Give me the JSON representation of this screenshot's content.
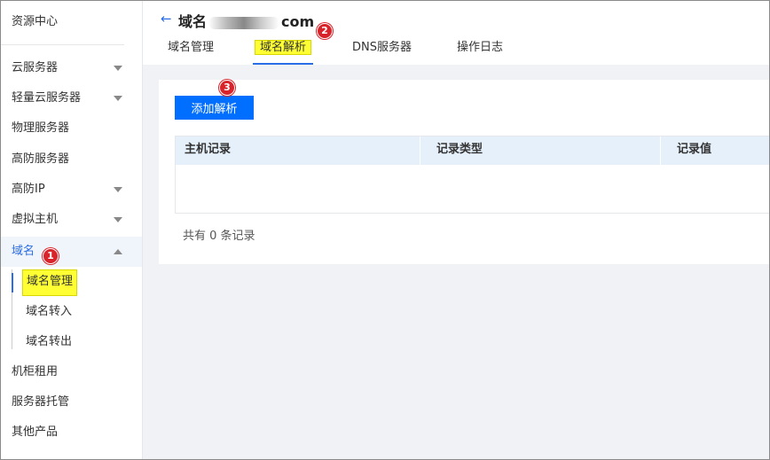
{
  "sidebar": {
    "top_label": "资源中心",
    "items": [
      {
        "label": "云服务器",
        "has_caret": true
      },
      {
        "label": "轻量云服务器",
        "has_caret": true
      },
      {
        "label": "物理服务器",
        "has_caret": false
      },
      {
        "label": "高防服务器",
        "has_caret": false
      },
      {
        "label": "高防IP",
        "has_caret": true
      },
      {
        "label": "虚拟主机",
        "has_caret": true
      },
      {
        "label": "域名",
        "has_caret": true,
        "expanded": true
      },
      {
        "label": "机柜租用",
        "has_caret": false
      },
      {
        "label": "服务器托管",
        "has_caret": false
      },
      {
        "label": "其他产品",
        "has_caret": false
      }
    ],
    "sub_items": [
      {
        "label": "域名管理",
        "highlighted": true
      },
      {
        "label": "域名转入",
        "highlighted": false
      },
      {
        "label": "域名转出",
        "highlighted": false
      }
    ]
  },
  "header": {
    "back_icon": "←",
    "title_prefix": "域名",
    "title_suffix": "com",
    "tabs": [
      {
        "label": "域名管理"
      },
      {
        "label": "域名解析",
        "active": true
      },
      {
        "label": "DNS服务器"
      },
      {
        "label": "操作日志"
      }
    ]
  },
  "main": {
    "add_button": "添加解析",
    "table": {
      "columns": [
        "主机记录",
        "记录类型",
        "记录值"
      ],
      "rows": []
    },
    "footer": "共有 0 条记录"
  },
  "badges": [
    "1",
    "2",
    "3"
  ],
  "colors": {
    "accent": "#2b6de5",
    "button": "#006eff",
    "badge": "#d8232a",
    "highlight": "#ffff33"
  }
}
